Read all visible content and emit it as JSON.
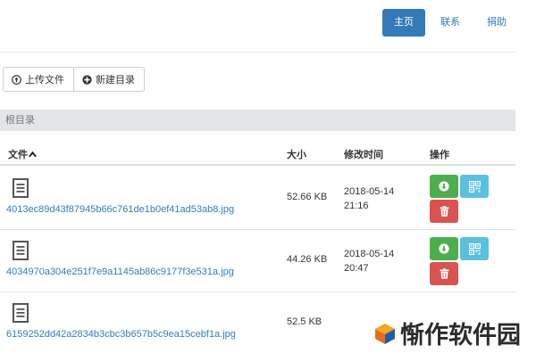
{
  "nav": {
    "home": "主页",
    "contact": "联系",
    "donate": "捐助"
  },
  "toolbar": {
    "upload_label": "上传文件",
    "new_dir_label": "新建目录"
  },
  "breadcrumb": {
    "root": "根目录"
  },
  "table": {
    "headers": {
      "name": "文件",
      "size": "大小",
      "modified": "修改时间",
      "actions": "操作"
    },
    "rows": [
      {
        "name": "4013ec89d43f87945b66c761de1b0ef41ad53ab8.jpg",
        "size": "52.66 KB",
        "date": "2018-05-14",
        "time": "21:16"
      },
      {
        "name": "4034970a304e251f7e9a1145ab86c9177f3e531a.jpg",
        "size": "44.26 KB",
        "date": "2018-05-14",
        "time": "20:47"
      },
      {
        "name": "6159252dd42a2834b3cbc3b657b5c9ea15cebf1a.jpg",
        "size": "52.5 KB",
        "date": "",
        "time": ""
      }
    ]
  },
  "watermark": {
    "text": "惭作软件园"
  },
  "colors": {
    "primary": "#337ab7",
    "success": "#4cae4c",
    "info": "#5bc0de",
    "danger": "#d9534f",
    "link": "#2f7fb8"
  }
}
